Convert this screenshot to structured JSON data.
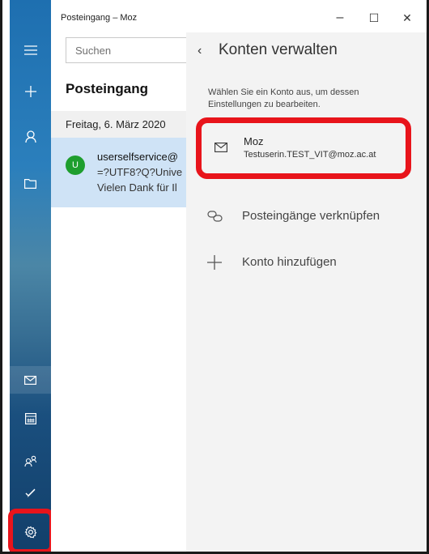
{
  "window": {
    "title": "Posteingang – Moz"
  },
  "search": {
    "placeholder": "Suchen"
  },
  "list": {
    "heading": "Posteingang",
    "date_group": "Freitag, 6. März 2020",
    "message": {
      "avatar_letter": "U",
      "sender": "userselfservice@",
      "subject": "=?UTF8?Q?Unive",
      "preview": "Vielen Dank für Il"
    }
  },
  "settings": {
    "back_glyph": "‹",
    "title": "Konten verwalten",
    "description": "Wählen Sie ein Konto aus, um dessen Einstellungen zu bearbeiten.",
    "account": {
      "name": "Moz",
      "email": "Testuserin.TEST_VIT@moz.ac.at"
    },
    "link_inboxes": "Posteingänge verknüpfen",
    "add_account": "Konto hinzufügen"
  },
  "controls": {
    "minimize": "–",
    "maximize": "☐",
    "close": "✕"
  },
  "colors": {
    "accent": "#1e6fb0",
    "highlight": "#e8141b",
    "selected": "#cfe3f6",
    "avatar": "#1e9e2e"
  }
}
